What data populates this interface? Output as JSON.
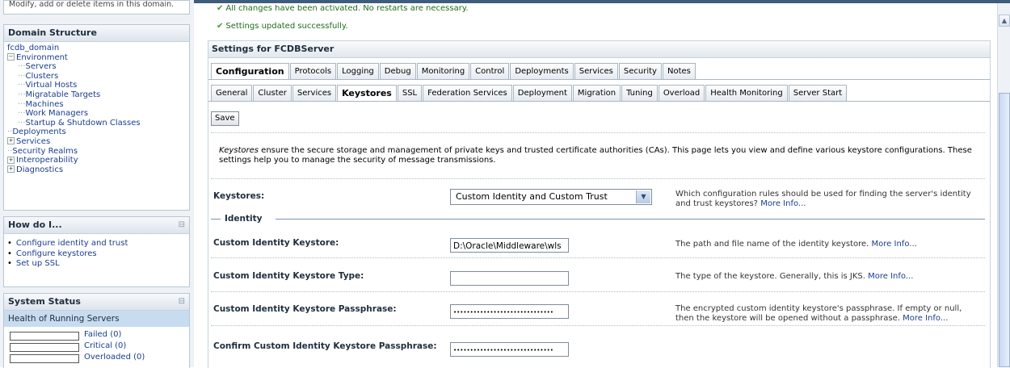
{
  "left": {
    "top_clip": "Modify, add or delete items in this domain.",
    "domain_structure": {
      "title": "Domain Structure",
      "domain": "fcdb_domain",
      "environment": "Environment",
      "env_items": [
        "Servers",
        "Clusters",
        "Virtual Hosts",
        "Migratable Targets",
        "Machines",
        "Work Managers",
        "Startup & Shutdown Classes"
      ],
      "deployments": "Deployments",
      "services": "Services",
      "security_realms": "Security Realms",
      "interoperability": "Interoperability",
      "diagnostics": "Diagnostics"
    },
    "how_do_i": {
      "title": "How do I...",
      "items": [
        "Configure identity and trust",
        "Configure keystores",
        "Set up SSL"
      ]
    },
    "system_status": {
      "title": "System Status",
      "subtitle": "Health of Running Servers",
      "rows": [
        "Failed (0)",
        "Critical (0)",
        "Overloaded (0)"
      ]
    }
  },
  "messages": {
    "activated": "All changes have been activated. No restarts are necessary.",
    "updated": "Settings updated successfully."
  },
  "settings": {
    "title": "Settings for FCDBServer",
    "tabs_top": [
      "Configuration",
      "Protocols",
      "Logging",
      "Debug",
      "Monitoring",
      "Control",
      "Deployments",
      "Services",
      "Security",
      "Notes"
    ],
    "tabs_sub": [
      "General",
      "Cluster",
      "Services",
      "Keystores",
      "SSL",
      "Federation Services",
      "Deployment",
      "Migration",
      "Tuning",
      "Overload",
      "Health Monitoring",
      "Server Start"
    ],
    "save_label": "Save",
    "desc_em": "Keystores",
    "desc_rest": " ensure the secure storage and management of private keys and trusted certificate authorities (CAs). This page lets you view and define various keystore configurations. These settings help you to manage the security of message transmissions.",
    "more_info": "More Info...",
    "keystores": {
      "label": "Keystores:",
      "value": "Custom Identity and Custom Trust",
      "help": "Which configuration rules should be used for finding the server's identity and trust keystores?"
    },
    "identity_legend": "Identity",
    "custom_identity_keystore": {
      "label": "Custom Identity Keystore:",
      "value": "D:\\Oracle\\Middleware\\wls",
      "help": "The path and file name of the identity keystore."
    },
    "custom_identity_type": {
      "label": "Custom Identity Keystore Type:",
      "value": "",
      "help": "The type of the keystore. Generally, this is JKS."
    },
    "custom_identity_pass": {
      "label": "Custom Identity Keystore Passphrase:",
      "value": "••••••••••••••••••••••••••••••",
      "help": "The encrypted custom identity keystore's passphrase. If empty or null, then the keystore will be opened without a passphrase."
    },
    "confirm_pass": {
      "label": "Confirm Custom Identity Keystore Passphrase:",
      "value": "••••••••••••••••••••••••••••••"
    }
  }
}
